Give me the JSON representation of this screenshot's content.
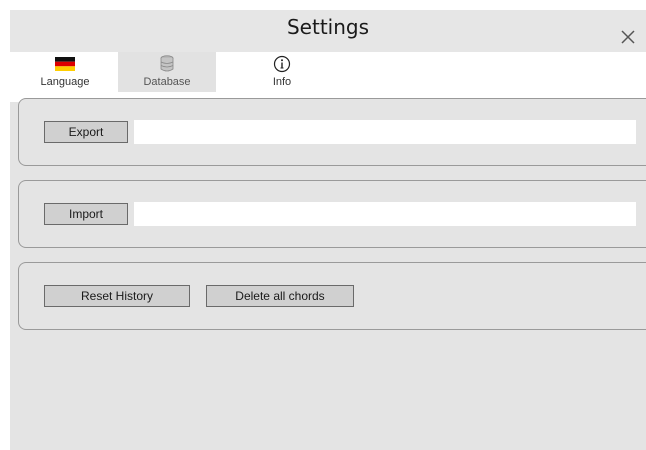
{
  "window": {
    "title": "Settings",
    "close_icon": "close-icon"
  },
  "tabs": [
    {
      "label": "Language",
      "icon": "german-flag-icon",
      "active": false
    },
    {
      "label": "Database",
      "icon": "database-icon",
      "active": true
    },
    {
      "label": "Info",
      "icon": "info-icon",
      "active": false
    }
  ],
  "export": {
    "button_label": "Export",
    "path_value": ""
  },
  "import": {
    "button_label": "Import",
    "path_value": ""
  },
  "actions": {
    "reset_history_label": "Reset History",
    "delete_chords_label": "Delete all chords"
  },
  "colors": {
    "background": "#e4e4e4",
    "button": "#d0d0d0",
    "panel_border": "#9a9a9a"
  }
}
